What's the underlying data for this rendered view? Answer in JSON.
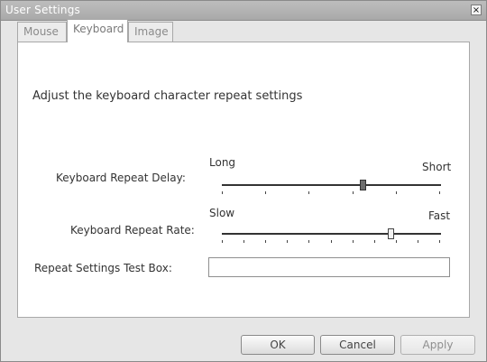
{
  "window": {
    "title": "User Settings",
    "close_glyph": "×"
  },
  "tabs": [
    {
      "label": "Mouse",
      "selected": false
    },
    {
      "label": "Keyboard",
      "selected": true
    },
    {
      "label": "Image",
      "selected": false
    }
  ],
  "keyboard": {
    "intro": "Adjust the keyboard character repeat settings",
    "repeat_delay": {
      "label": "Keyboard Repeat Delay:",
      "min_label": "Long",
      "max_label": "Short",
      "value": 0.65,
      "tick_count": 6
    },
    "repeat_rate": {
      "label": "Keyboard Repeat Rate:",
      "min_label": "Slow",
      "max_label": "Fast",
      "value": 0.78,
      "tick_count": 11
    },
    "test_box": {
      "label": "Repeat Settings Test Box:",
      "value": ""
    }
  },
  "buttons": {
    "ok": "OK",
    "cancel": "Cancel",
    "apply": "Apply"
  },
  "icons": {
    "close": "close-icon"
  }
}
